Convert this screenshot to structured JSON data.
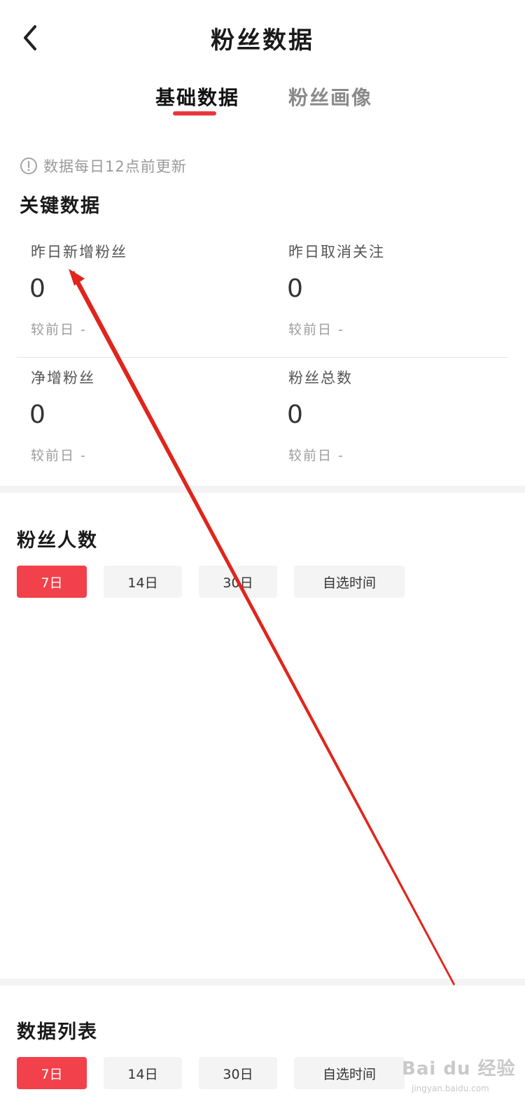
{
  "header": {
    "title": "粉丝数据",
    "back_icon": "chevron-left-icon"
  },
  "tabs": [
    {
      "label": "基础数据",
      "active": true
    },
    {
      "label": "粉丝画像",
      "active": false
    }
  ],
  "notice": {
    "icon": "info-icon",
    "text": "数据每日12点前更新"
  },
  "key_data": {
    "title": "关键数据",
    "metrics": [
      {
        "label": "昨日新增粉丝",
        "value": "0",
        "compare": "较前日  -"
      },
      {
        "label": "昨日取消关注",
        "value": "0",
        "compare": "较前日  -"
      },
      {
        "label": "净增粉丝",
        "value": "0",
        "compare": "较前日  -"
      },
      {
        "label": "粉丝总数",
        "value": "0",
        "compare": "较前日  -"
      }
    ]
  },
  "fan_count": {
    "title": "粉丝人数",
    "filters": [
      "7日",
      "14日",
      "30日",
      "自选时间"
    ],
    "selected": "7日"
  },
  "data_list": {
    "title": "数据列表",
    "filters": [
      "7日",
      "14日",
      "30日",
      "自选时间"
    ],
    "selected": "7日"
  },
  "colors": {
    "accent": "#f2414a",
    "tab_underline": "#e8373c",
    "annotation_arrow": "#e0251c"
  },
  "watermark": {
    "text": "Bai du 经验",
    "sub": "jingyan.baidu.com"
  }
}
